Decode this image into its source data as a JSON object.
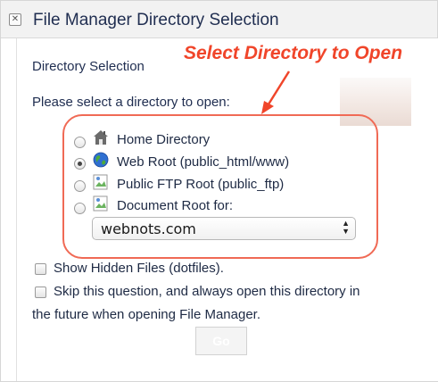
{
  "window": {
    "title": "File Manager Directory Selection",
    "close_icon": "close-x-icon"
  },
  "section": {
    "title": "Directory Selection",
    "prompt": "Please select a directory to open:"
  },
  "annotation": {
    "text": "Select Directory to Open",
    "color": "#f0452a"
  },
  "options": [
    {
      "label": "Home Directory",
      "icon": "home-icon",
      "checked": false
    },
    {
      "label": "Web Root (public_html/www)",
      "icon": "globe-icon",
      "checked": true
    },
    {
      "label": "Public FTP Root (public_ftp)",
      "icon": "broken-image-icon",
      "checked": false
    },
    {
      "label": "Document Root for:",
      "icon": "broken-image-icon",
      "checked": false
    }
  ],
  "domain_select": {
    "value": "webnots.com"
  },
  "checkboxes": [
    {
      "label": "Show Hidden Files (dotfiles).",
      "checked": false
    },
    {
      "label": "Skip this question, and always open this directory in",
      "checked": false
    }
  ],
  "checkbox_continuation": "the future when opening File Manager.",
  "go_button": {
    "label": "Go"
  }
}
